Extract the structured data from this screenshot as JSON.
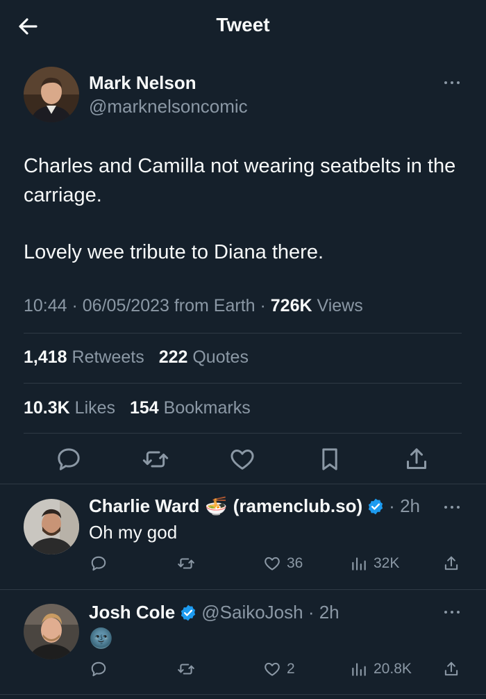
{
  "header": {
    "title": "Tweet"
  },
  "tweet": {
    "author_name": "Mark Nelson",
    "author_handle": "@marknelsoncomic",
    "text_line1": "Charles and Camilla not wearing seatbelts in the carriage.",
    "text_line2": "Lovely wee tribute to Diana there.",
    "time": "10:44",
    "date": "06/05/2023",
    "source": "from Earth",
    "views_count": "726K",
    "views_label": "Views",
    "retweets_count": "1,418",
    "retweets_label": "Retweets",
    "quotes_count": "222",
    "quotes_label": "Quotes",
    "likes_count": "10.3K",
    "likes_label": "Likes",
    "bookmarks_count": "154",
    "bookmarks_label": "Bookmarks"
  },
  "replies": [
    {
      "name": "Charlie Ward",
      "emoji": "🍜",
      "name_suffix": "(ramenclub.so)",
      "verified": true,
      "time": "2h",
      "text": "Oh my god",
      "likes": "36",
      "views": "32K"
    },
    {
      "name": "Josh Cole",
      "verified": true,
      "handle": "@SaikoJosh",
      "time": "2h",
      "text": "🌚",
      "likes": "2",
      "views": "20.8K"
    }
  ],
  "colors": {
    "background": "#15202b",
    "text": "#f7f9f9",
    "muted": "#8b98a5",
    "divider": "#2f3a45",
    "verified": "#1d9bf0"
  },
  "icons": [
    "back-arrow-icon",
    "more-icon",
    "reply-icon",
    "retweet-icon",
    "like-icon",
    "bookmark-icon",
    "share-icon",
    "views-icon",
    "verified-badge-icon"
  ]
}
